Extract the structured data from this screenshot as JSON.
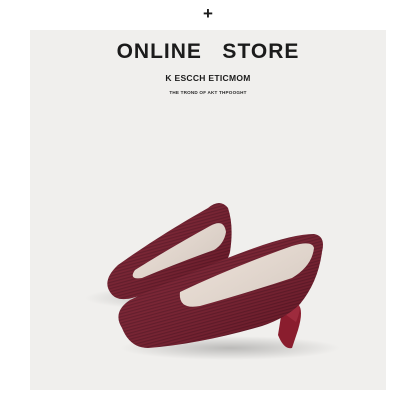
{
  "header": {
    "plus_symbol": "+"
  },
  "banner": {
    "title": "ONLINE   STORE",
    "subtitle": "K ESCCH ETICMOM",
    "tagline": "THE TROND OF AKT THPOOGHT"
  },
  "product": {
    "color": "#7a1a2a",
    "insole_color": "#efe2d8",
    "heel_color": "#8a1d2e"
  }
}
